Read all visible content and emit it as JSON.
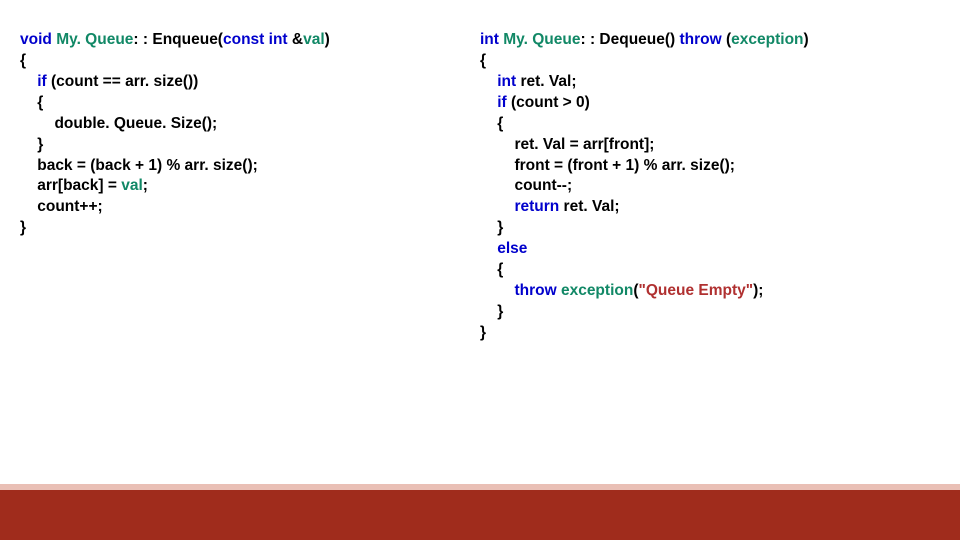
{
  "left": [
    [
      [
        "kw",
        "void"
      ],
      [
        "",
        " "
      ],
      [
        "cls",
        "My. Queue"
      ],
      [
        "",
        ": : Enqueue("
      ],
      [
        "kw",
        "const"
      ],
      [
        "",
        " "
      ],
      [
        "kw",
        "int"
      ],
      [
        "",
        " &"
      ],
      [
        "cls",
        "val"
      ],
      [
        "",
        ")"
      ]
    ],
    [
      [
        "",
        "{"
      ]
    ],
    [
      [
        "",
        "    "
      ],
      [
        "kw",
        "if"
      ],
      [
        "",
        " (count == arr. size())"
      ]
    ],
    [
      [
        "",
        "    {"
      ]
    ],
    [
      [
        "",
        "        double. Queue. Size();"
      ]
    ],
    [
      [
        "",
        "    }"
      ]
    ],
    [
      [
        "",
        "    back = (back + 1) % arr. size();"
      ]
    ],
    [
      [
        "",
        "    arr[back] = "
      ],
      [
        "cls",
        "val"
      ],
      [
        "",
        ";"
      ]
    ],
    [
      [
        "",
        "    count++;"
      ]
    ],
    [
      [
        "",
        "}"
      ]
    ]
  ],
  "right": [
    [
      [
        "kw",
        "int"
      ],
      [
        "",
        " "
      ],
      [
        "cls",
        "My. Queue"
      ],
      [
        "",
        ": : Dequeue() "
      ],
      [
        "kw",
        "throw"
      ],
      [
        "",
        " ("
      ],
      [
        "cls",
        "exception"
      ],
      [
        "",
        ")"
      ]
    ],
    [
      [
        "",
        "{"
      ]
    ],
    [
      [
        "",
        "    "
      ],
      [
        "kw",
        "int"
      ],
      [
        "",
        " ret. Val;"
      ]
    ],
    [
      [
        "",
        "    "
      ],
      [
        "kw",
        "if"
      ],
      [
        "",
        " (count > 0)"
      ]
    ],
    [
      [
        "",
        "    {"
      ]
    ],
    [
      [
        "",
        "        ret. Val = arr[front];"
      ]
    ],
    [
      [
        "",
        "        front = (front + 1) % arr. size();"
      ]
    ],
    [
      [
        "",
        "        count--;"
      ]
    ],
    [
      [
        "",
        "        "
      ],
      [
        "kw",
        "return"
      ],
      [
        "",
        " ret. Val;"
      ]
    ],
    [
      [
        "",
        "    }"
      ]
    ],
    [
      [
        "",
        "    "
      ],
      [
        "kw",
        "else"
      ]
    ],
    [
      [
        "",
        "    {"
      ]
    ],
    [
      [
        "",
        "        "
      ],
      [
        "kw",
        "throw"
      ],
      [
        "",
        " "
      ],
      [
        "cls",
        "exception"
      ],
      [
        "",
        "("
      ],
      [
        "str",
        "\"Queue Empty\""
      ],
      [
        "",
        ");"
      ]
    ],
    [
      [
        "",
        "    }"
      ]
    ],
    [
      [
        "",
        "}"
      ]
    ]
  ]
}
